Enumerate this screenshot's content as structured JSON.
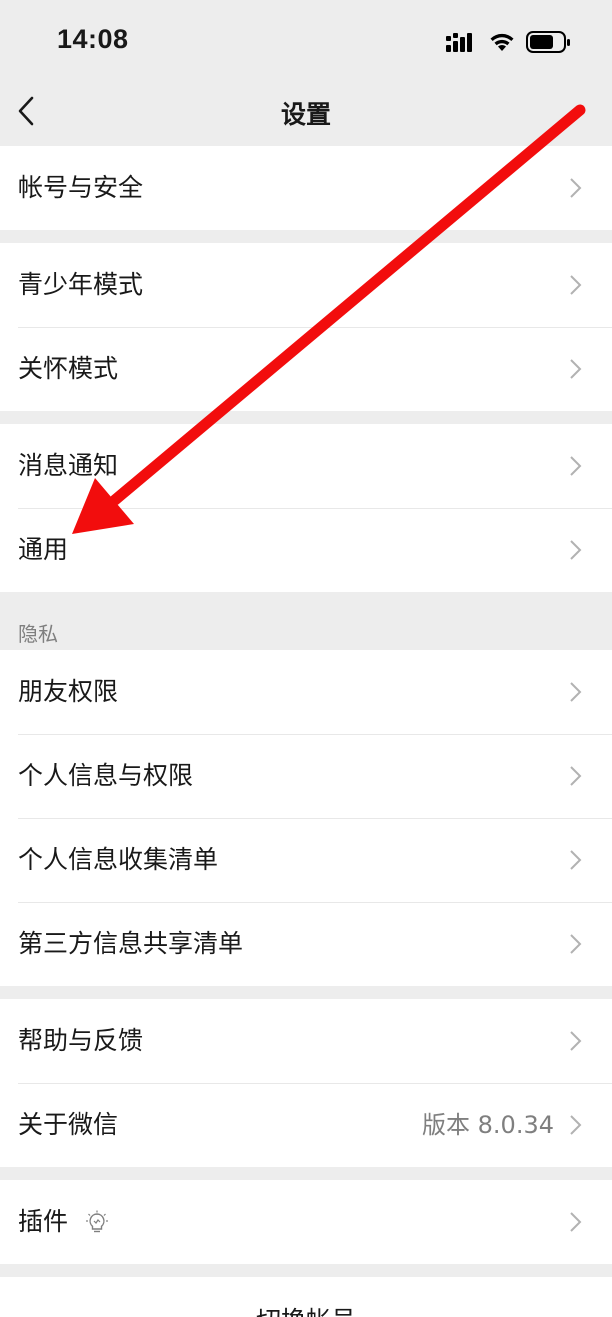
{
  "status_bar": {
    "time": "14:08",
    "icons": [
      "cellular-signal-icon",
      "wifi-icon",
      "battery-icon"
    ]
  },
  "nav": {
    "back_icon": "chevron-left-icon",
    "title": "设置"
  },
  "groups": [
    {
      "items": [
        {
          "label": "帐号与安全"
        }
      ]
    },
    {
      "items": [
        {
          "label": "青少年模式"
        },
        {
          "label": "关怀模式"
        }
      ]
    },
    {
      "items": [
        {
          "label": "消息通知"
        },
        {
          "label": "通用"
        }
      ]
    },
    {
      "header": "隐私",
      "items": [
        {
          "label": "朋友权限"
        },
        {
          "label": "个人信息与权限"
        },
        {
          "label": "个人信息收集清单"
        },
        {
          "label": "第三方信息共享清单"
        }
      ]
    },
    {
      "items": [
        {
          "label": "帮助与反馈"
        },
        {
          "label": "关于微信",
          "value": "版本 8.0.34"
        }
      ]
    },
    {
      "items": [
        {
          "label": "插件",
          "icon": "lightbulb-icon"
        }
      ]
    }
  ],
  "bottom": {
    "switch_account_label": "切换帐号"
  },
  "annotation": {
    "arrow_color": "#f20d0d",
    "arrow_target": "通用"
  },
  "colors": {
    "background": "#ededed",
    "card": "#ffffff",
    "text": "#191919",
    "secondary_text": "#7f7f7f"
  }
}
